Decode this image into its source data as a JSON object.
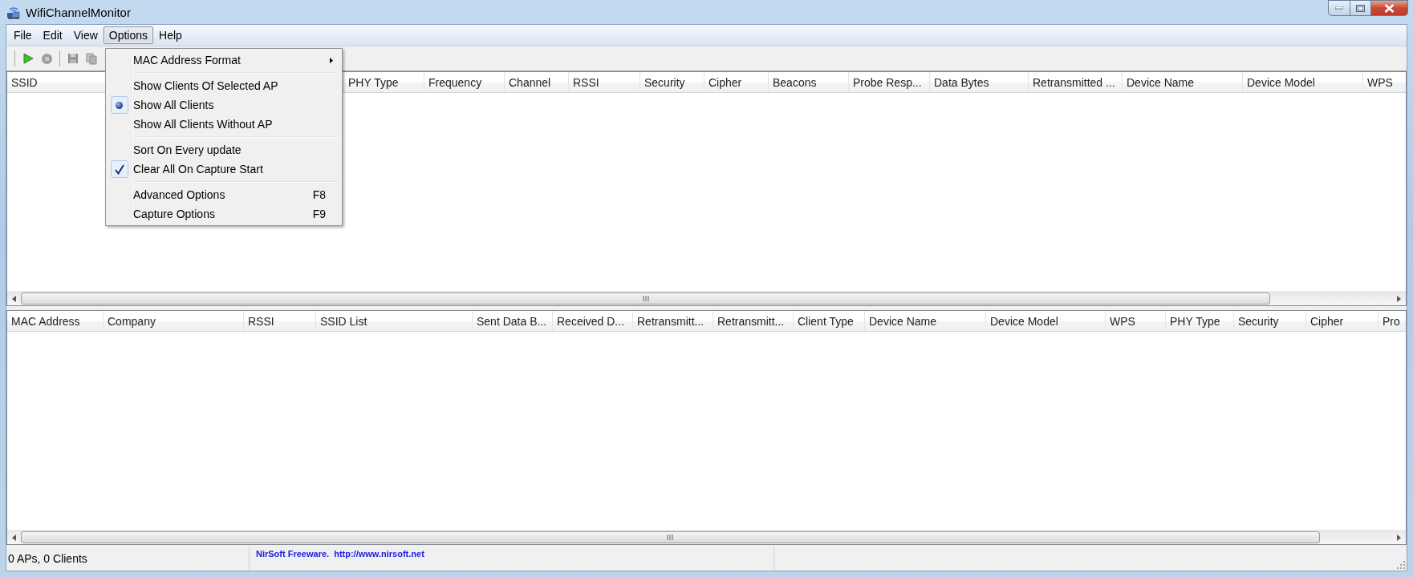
{
  "window": {
    "title": "WifiChannelMonitor"
  },
  "menu_bar": [
    {
      "label": "File",
      "selected": false
    },
    {
      "label": "Edit",
      "selected": false
    },
    {
      "label": "View",
      "selected": false
    },
    {
      "label": "Options",
      "selected": true
    },
    {
      "label": "Help",
      "selected": false
    }
  ],
  "toolbar": [
    {
      "kind": "start",
      "disabled": false
    },
    {
      "kind": "stop",
      "disabled": true
    },
    {
      "kind": "save",
      "disabled": true
    },
    {
      "kind": "copy",
      "disabled": true
    }
  ],
  "options_menu": [
    {
      "kind": "submenu",
      "label": "MAC Address Format"
    },
    {
      "kind": "separator"
    },
    {
      "kind": "radio",
      "label": "Show Clients Of Selected AP",
      "checked": false
    },
    {
      "kind": "radio",
      "label": "Show All Clients",
      "checked": true
    },
    {
      "kind": "radio",
      "label": "Show All Clients Without AP",
      "checked": false
    },
    {
      "kind": "separator"
    },
    {
      "kind": "check",
      "label": "Sort On Every update",
      "checked": false
    },
    {
      "kind": "check",
      "label": "Clear All On Capture Start",
      "checked": true
    },
    {
      "kind": "separator"
    },
    {
      "kind": "command",
      "label": "Advanced Options",
      "shortcut": "F8"
    },
    {
      "kind": "command",
      "label": "Capture Options",
      "shortcut": "F9"
    }
  ],
  "access_points_table": {
    "columns": [
      "SSID",
      "PHY Type",
      "Frequency",
      "Channel",
      "RSSI",
      "Security",
      "Cipher",
      "Beacons",
      "Probe Resp...",
      "Data Bytes",
      "Retransmitted ...",
      "Device Name",
      "Device Model",
      "WPS"
    ]
  },
  "clients_table": {
    "columns": [
      "MAC Address",
      "Company",
      "RSSI",
      "SSID List",
      "Sent Data B...",
      "Received D...",
      "Retransmitt...",
      "Retransmitt...",
      "Client Type",
      "Device Name",
      "Device Model",
      "WPS",
      "PHY Type",
      "Security",
      "Cipher",
      "Pro"
    ]
  },
  "status_bar": {
    "counts": "0 APs, 0 Clients",
    "link": "NirSoft Freeware.  http://www.nirsoft.net"
  }
}
